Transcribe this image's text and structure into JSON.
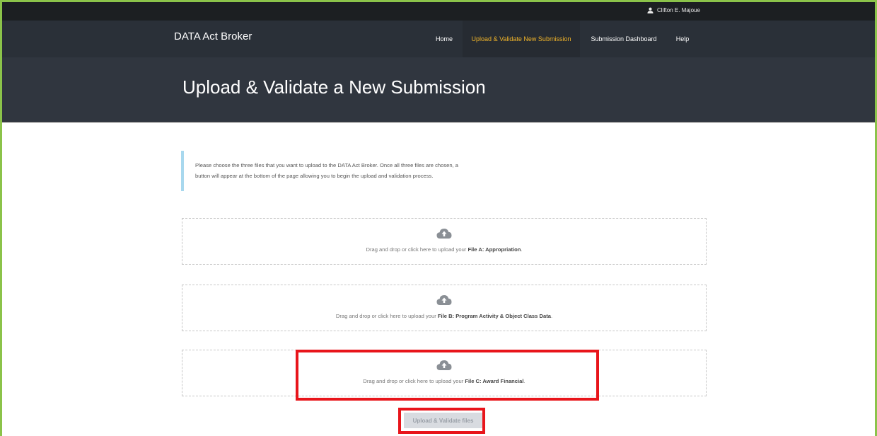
{
  "topbar": {
    "user_name": "Clifton E. Majoue",
    "user_icon": "user-icon"
  },
  "navbar": {
    "brand": "DATA Act Broker",
    "items": [
      {
        "label": "Home",
        "active": false
      },
      {
        "label": "Upload & Validate New Submission",
        "active": true
      },
      {
        "label": "Submission Dashboard",
        "active": false
      },
      {
        "label": "Help",
        "active": false
      }
    ]
  },
  "hero": {
    "title": "Upload & Validate a New Submission"
  },
  "info": {
    "line1": "Please choose the three files that you want to upload to the DATA Act Broker. Once all three files are chosen, a",
    "line2": "button will appear at the bottom of the page allowing you to begin the upload and validation process."
  },
  "dropzones": [
    {
      "prefix": "Drag and drop or click here to upload your ",
      "file": "File A: Appropriation",
      "suffix": ".",
      "icon": "cloud-upload-icon"
    },
    {
      "prefix": "Drag and drop or click here to upload your ",
      "file": "File B: Program Activity & Object Class Data",
      "suffix": ".",
      "icon": "cloud-upload-icon"
    },
    {
      "prefix": "Drag and drop or click here to upload your ",
      "file": "File C: Award Financial",
      "suffix": ".",
      "icon": "cloud-upload-icon"
    }
  ],
  "upload_button": {
    "label": "Upload & Validate files"
  },
  "colors": {
    "highlight": "#e8151b",
    "active_nav": "#f0b429",
    "frame": "#8bc34a"
  }
}
